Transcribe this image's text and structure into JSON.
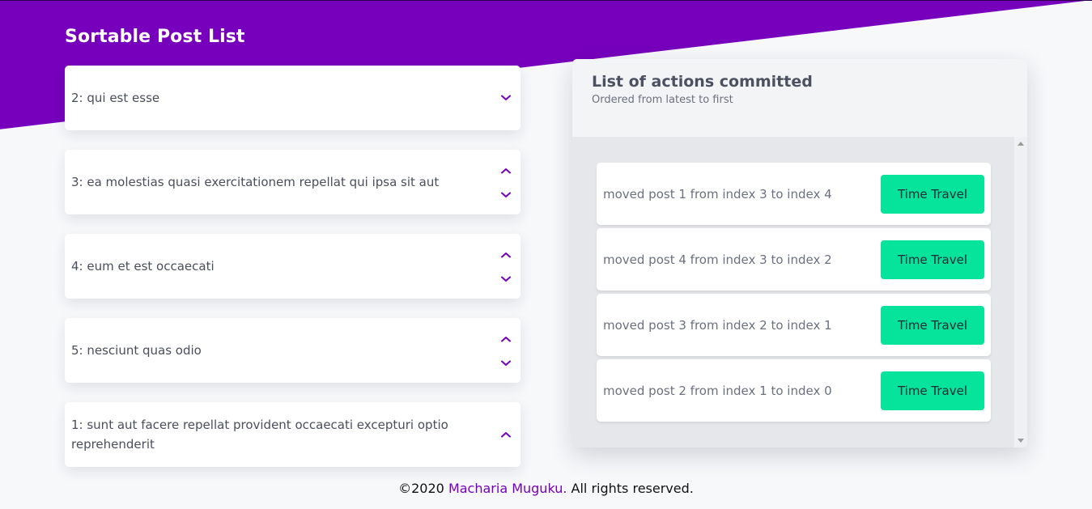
{
  "header": {
    "title": "Sortable Post List"
  },
  "posts": [
    {
      "label": "2: qui est esse",
      "arrows": [
        "down"
      ]
    },
    {
      "label": "3: ea molestias quasi exercitationem repellat qui ipsa sit aut",
      "arrows": [
        "up",
        "down"
      ]
    },
    {
      "label": "4: eum et est occaecati",
      "arrows": [
        "up",
        "down"
      ]
    },
    {
      "label": "5: nesciunt quas odio",
      "arrows": [
        "up",
        "down"
      ]
    },
    {
      "label": "1: sunt aut facere repellat provident occaecati excepturi optio reprehenderit",
      "arrows": [
        "up"
      ]
    }
  ],
  "actions_panel": {
    "title": "List of actions committed",
    "subtitle": "Ordered from latest to first",
    "items": [
      {
        "text": "moved post 1 from index 3 to index 4",
        "button_label": "Time Travel"
      },
      {
        "text": "moved post 4 from index 3 to index 2",
        "button_label": "Time Travel"
      },
      {
        "text": "moved post 3 from index 2 to index 1",
        "button_label": "Time Travel"
      },
      {
        "text": "moved post 2 from index 1 to index 0",
        "button_label": "Time Travel"
      }
    ]
  },
  "footer": {
    "prefix": "©2020 ",
    "author": "Macharia Muguku.",
    "suffix": " All rights reserved."
  },
  "colors": {
    "brand_purple": "#7600bc",
    "button_green": "#06e39a",
    "page_background": "#f7f8fa",
    "panel_background": "#e5e7eb"
  },
  "icons": {
    "up": "chevron-up-icon",
    "down": "chevron-down-icon"
  }
}
